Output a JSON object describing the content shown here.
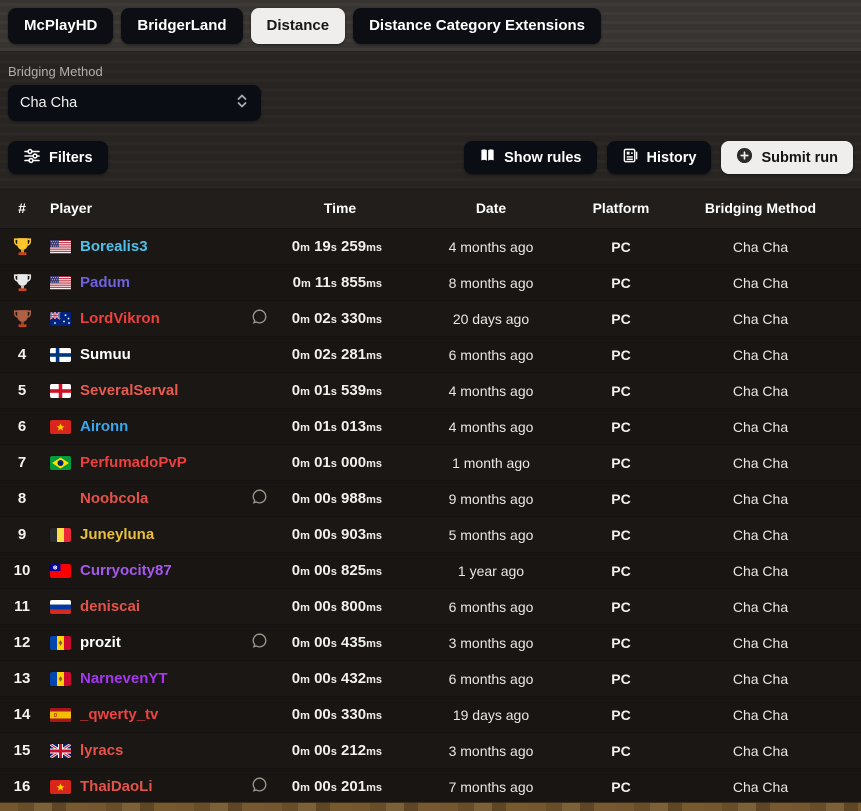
{
  "tabs": [
    {
      "label": "McPlayHD",
      "active": false
    },
    {
      "label": "BridgerLand",
      "active": false
    },
    {
      "label": "Distance",
      "active": true
    },
    {
      "label": "Distance Category Extensions",
      "active": false
    }
  ],
  "filter": {
    "label": "Bridging Method",
    "value": "Cha Cha"
  },
  "toolbar": {
    "filters_label": "Filters",
    "show_rules_label": "Show rules",
    "history_label": "History",
    "submit_label": "Submit run"
  },
  "table": {
    "headers": [
      "#",
      "Player",
      "Time",
      "Date",
      "Platform",
      "Bridging Method"
    ],
    "time_units": {
      "m": "m",
      "s": "s",
      "ms": "ms"
    },
    "rows": [
      {
        "rank": "1",
        "trophy": "gold",
        "flag": "us",
        "player": "Borealis3",
        "name_color": "#4fc0ea",
        "comment": false,
        "time": {
          "m": "0",
          "s": "19",
          "ms": "259"
        },
        "date": "4 months ago",
        "platform": "PC",
        "method": "Cha Cha"
      },
      {
        "rank": "2",
        "trophy": "silver",
        "flag": "us",
        "player": "Padum",
        "name_color": "#6e62dd",
        "comment": false,
        "time": {
          "m": "0",
          "s": "11",
          "ms": "855"
        },
        "date": "8 months ago",
        "platform": "PC",
        "method": "Cha Cha"
      },
      {
        "rank": "3",
        "trophy": "bronze",
        "flag": "au",
        "player": "LordVikron",
        "name_color": "#ee3f3f",
        "comment": true,
        "time": {
          "m": "0",
          "s": "02",
          "ms": "330"
        },
        "date": "20 days ago",
        "platform": "PC",
        "method": "Cha Cha"
      },
      {
        "rank": "4",
        "trophy": null,
        "flag": "fi",
        "player": "Sumuu",
        "name_color": "#ffffff",
        "comment": false,
        "time": {
          "m": "0",
          "s": "02",
          "ms": "281"
        },
        "date": "6 months ago",
        "platform": "PC",
        "method": "Cha Cha"
      },
      {
        "rank": "5",
        "trophy": null,
        "flag": "england",
        "player": "SeveralServal",
        "name_color": "#e85a50",
        "comment": false,
        "time": {
          "m": "0",
          "s": "01",
          "ms": "539"
        },
        "date": "4 months ago",
        "platform": "PC",
        "method": "Cha Cha"
      },
      {
        "rank": "6",
        "trophy": null,
        "flag": "vn",
        "player": "Aironn",
        "name_color": "#38a7f0",
        "comment": false,
        "time": {
          "m": "0",
          "s": "01",
          "ms": "013"
        },
        "date": "4 months ago",
        "platform": "PC",
        "method": "Cha Cha"
      },
      {
        "rank": "7",
        "trophy": null,
        "flag": "br",
        "player": "PerfumadoPvP",
        "name_color": "#ee4040",
        "comment": false,
        "time": {
          "m": "0",
          "s": "01",
          "ms": "000"
        },
        "date": "1 month ago",
        "platform": "PC",
        "method": "Cha Cha"
      },
      {
        "rank": "8",
        "trophy": null,
        "flag": null,
        "player": "Noobcola",
        "name_color": "#e4534b",
        "comment": true,
        "time": {
          "m": "0",
          "s": "00",
          "ms": "988"
        },
        "date": "9 months ago",
        "platform": "PC",
        "method": "Cha Cha"
      },
      {
        "rank": "9",
        "trophy": null,
        "flag": "be",
        "player": "Juneyluna",
        "name_color": "#e8bf3e",
        "comment": false,
        "time": {
          "m": "0",
          "s": "00",
          "ms": "903"
        },
        "date": "5 months ago",
        "platform": "PC",
        "method": "Cha Cha"
      },
      {
        "rank": "10",
        "trophy": null,
        "flag": "tw",
        "player": "Curryocity87",
        "name_color": "#a558ef",
        "comment": false,
        "time": {
          "m": "0",
          "s": "00",
          "ms": "825"
        },
        "date": "1 year ago",
        "platform": "PC",
        "method": "Cha Cha"
      },
      {
        "rank": "11",
        "trophy": null,
        "flag": "ru",
        "player": "deniscai",
        "name_color": "#e4534b",
        "comment": false,
        "time": {
          "m": "0",
          "s": "00",
          "ms": "800"
        },
        "date": "6 months ago",
        "platform": "PC",
        "method": "Cha Cha"
      },
      {
        "rank": "12",
        "trophy": null,
        "flag": "md",
        "player": "prozit",
        "name_color": "#ffffff",
        "comment": true,
        "time": {
          "m": "0",
          "s": "00",
          "ms": "435"
        },
        "date": "3 months ago",
        "platform": "PC",
        "method": "Cha Cha"
      },
      {
        "rank": "13",
        "trophy": null,
        "flag": "md",
        "player": "NarnevenYT",
        "name_color": "#a438ef",
        "comment": false,
        "time": {
          "m": "0",
          "s": "00",
          "ms": "432"
        },
        "date": "6 months ago",
        "platform": "PC",
        "method": "Cha Cha"
      },
      {
        "rank": "14",
        "trophy": null,
        "flag": "es",
        "player": "_qwerty_tv",
        "name_color": "#ee4343",
        "comment": false,
        "time": {
          "m": "0",
          "s": "00",
          "ms": "330"
        },
        "date": "19 days ago",
        "platform": "PC",
        "method": "Cha Cha"
      },
      {
        "rank": "15",
        "trophy": null,
        "flag": "gb",
        "player": "lyracs",
        "name_color": "#e4534b",
        "comment": false,
        "time": {
          "m": "0",
          "s": "00",
          "ms": "212"
        },
        "date": "3 months ago",
        "platform": "PC",
        "method": "Cha Cha"
      },
      {
        "rank": "16",
        "trophy": null,
        "flag": "vn",
        "player": "ThaiDaoLi",
        "name_color": "#e4534b",
        "comment": true,
        "time": {
          "m": "0",
          "s": "00",
          "ms": "201"
        },
        "date": "7 months ago",
        "platform": "PC",
        "method": "Cha Cha"
      }
    ]
  },
  "colors": {
    "trophy_gold": "#ffc52f",
    "trophy_silver": "#e9e9ea",
    "trophy_bronze": "#b06045",
    "trophy_base": "#c6441f",
    "active_tab_bg": "#efeeec",
    "dark_button_bg": "#0b0d14",
    "name_default": "#ffffff"
  }
}
